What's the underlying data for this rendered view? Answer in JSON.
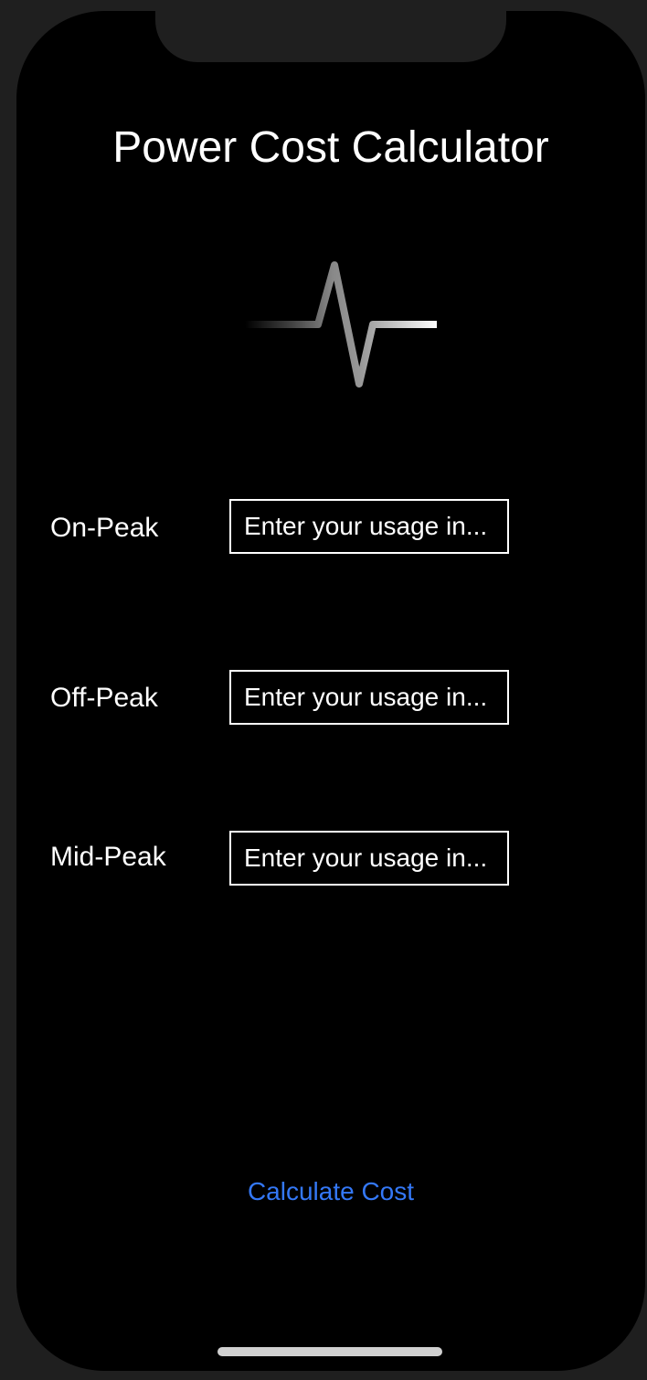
{
  "app": {
    "title": "Power Cost Calculator",
    "logo_icon": "pulse-waveform-icon"
  },
  "form": {
    "rows": [
      {
        "label": "On-Peak",
        "placeholder": "Enter your usage in...",
        "value": ""
      },
      {
        "label": "Off-Peak",
        "placeholder": "Enter your usage in...",
        "value": ""
      },
      {
        "label": "Mid-Peak",
        "placeholder": "Enter your usage in...",
        "value": ""
      }
    ],
    "submit_label": "Calculate Cost"
  },
  "colors": {
    "background": "#000000",
    "text": "#ffffff",
    "accent": "#3478f6"
  }
}
